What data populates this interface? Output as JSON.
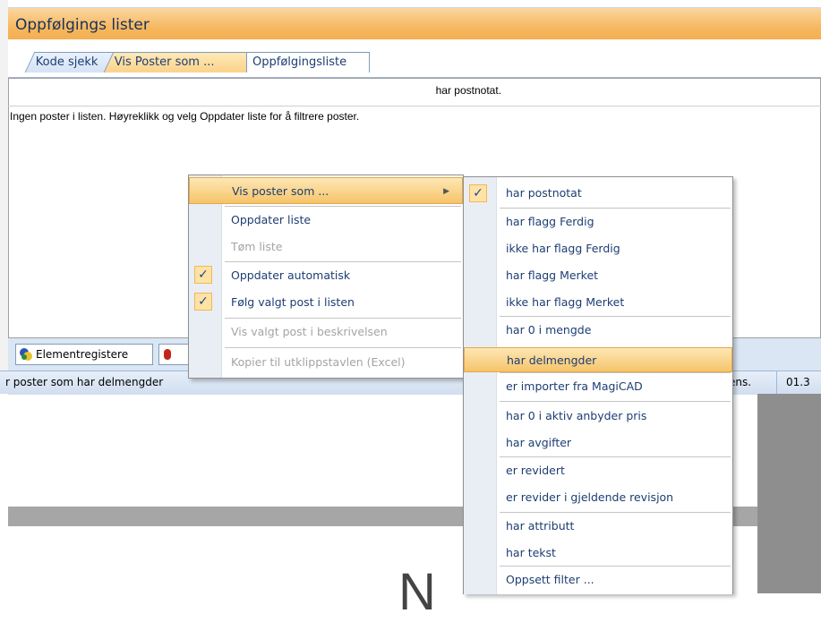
{
  "window": {
    "title": "Oppfølgings lister"
  },
  "tabs": [
    {
      "label": "Kode sjekk"
    },
    {
      "label": "Vis Poster som ..."
    },
    {
      "label": "Oppfølgingsliste"
    }
  ],
  "content": {
    "filter_label": "har postnotat.",
    "empty_message": "Ingen poster i listen. Høyreklikk og velg Oppdater liste for å filtrere poster."
  },
  "bottom_tabs": [
    {
      "label": "Elementregistere"
    }
  ],
  "statusbar": {
    "text": "r poster som har delmengder",
    "cell1": "ens.",
    "cell2": "01.3"
  },
  "background": {
    "ghost_text": "N"
  },
  "context_menu": {
    "items": [
      {
        "label": "Vis poster som ...",
        "highlighted": true,
        "has_submenu": true
      },
      {
        "label": "Oppdater liste"
      },
      {
        "label": "Tøm liste",
        "disabled": true
      },
      {
        "label": "Oppdater automatisk",
        "checked": true
      },
      {
        "label": "Følg valgt post i listen",
        "checked": true
      },
      {
        "label": "Vis valgt post i beskrivelsen",
        "disabled": true
      },
      {
        "label": "Kopier til utklippstavlen (Excel)",
        "disabled": true
      }
    ],
    "check_glyph": "✓",
    "arrow_glyph": "▶"
  },
  "submenu": {
    "items": [
      {
        "label": "har postnotat",
        "checked": true
      },
      {
        "label": "har flagg Ferdig"
      },
      {
        "label": "ikke har flagg Ferdig"
      },
      {
        "label": "har flagg Merket"
      },
      {
        "label": "ikke har flagg Merket"
      },
      {
        "label": "har 0 i mengde"
      },
      {
        "label": "har delmengder",
        "highlighted": true
      },
      {
        "label": "er importer fra MagiCAD"
      },
      {
        "label": "har 0 i aktiv anbyder pris"
      },
      {
        "label": "har avgifter"
      },
      {
        "label": "er revidert"
      },
      {
        "label": "er revider i gjeldende revisjon"
      },
      {
        "label": "har attributt"
      },
      {
        "label": "har tekst"
      },
      {
        "label": "Oppsett filter ..."
      }
    ]
  },
  "colors": {
    "title_bar": "#f6b860",
    "highlight": "#f6c46a",
    "menu_text": "#1d3d72",
    "disabled_text": "#a4a4a4"
  }
}
